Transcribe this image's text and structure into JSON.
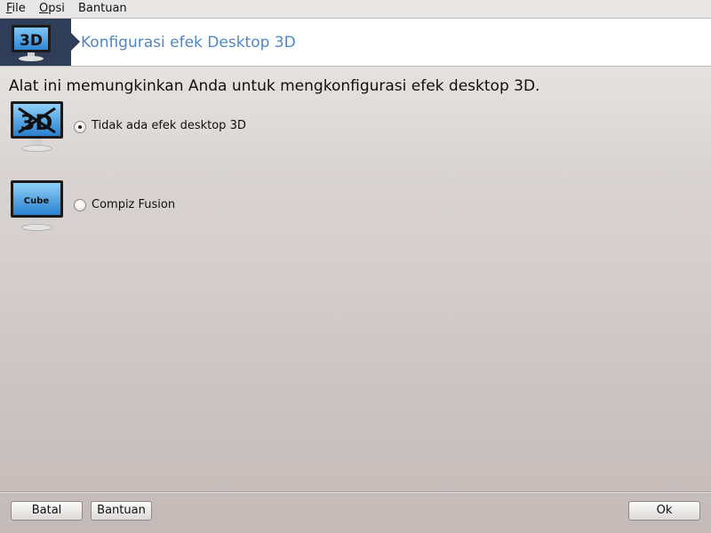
{
  "menubar": {
    "items": [
      {
        "first": "F",
        "rest": "ile"
      },
      {
        "first": "O",
        "rest": "psi"
      },
      {
        "first": "",
        "rest": "Bantuan"
      }
    ]
  },
  "header": {
    "logo_text": "3D",
    "title": "Konfigurasi efek Desktop 3D",
    "accent_color": "#4e88c5",
    "logo_bg": "#2f3d59"
  },
  "description": "Alat ini memungkinkan Anda untuk mengkonfigurasi efek desktop 3D.",
  "options": [
    {
      "icon": "3d-crossed-monitor-icon",
      "icon_text": "3D",
      "label": "Tidak ada efek desktop 3D",
      "selected": true
    },
    {
      "icon": "cube-monitor-icon",
      "icon_text": "Cube",
      "label": "Compiz Fusion",
      "selected": false
    }
  ],
  "footer": {
    "cancel_label": "Batal",
    "help_label": "Bantuan",
    "ok_label": "Ok"
  }
}
